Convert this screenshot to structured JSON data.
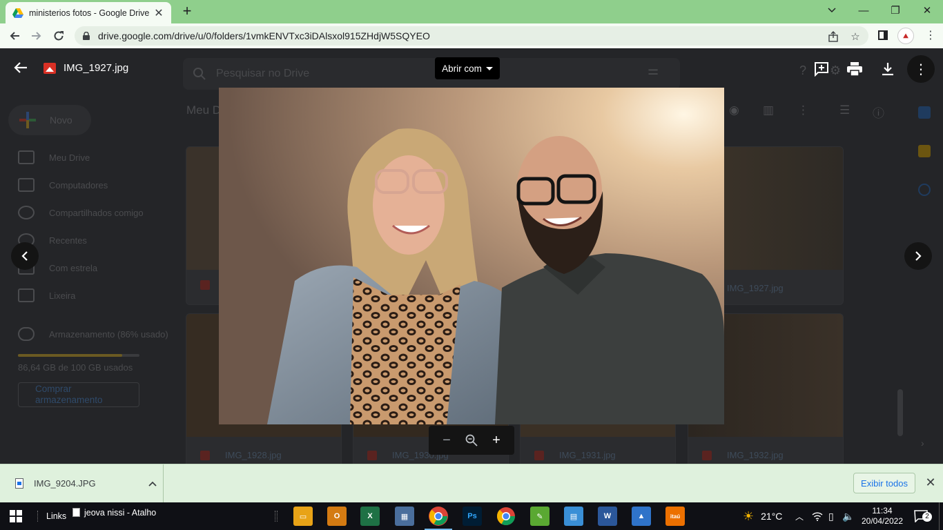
{
  "browser": {
    "tab_title": "ministerios fotos - Google Drive",
    "tab_close": "✕",
    "new_tab": "+",
    "url": "drive.google.com/drive/u/0/folders/1vmkENVTxc3iDAlsxol915ZHdjW5SQYEO",
    "win_min": "—",
    "win_restore": "❐",
    "win_close": "✕"
  },
  "drive": {
    "search_placeholder": "Pesquisar no Drive",
    "new_label": "Novo",
    "breadcrumb": "Meu Drive",
    "sidebar": [
      {
        "label": "Meu Drive",
        "icon": "drive-icon"
      },
      {
        "label": "Computadores",
        "icon": "computer-icon"
      },
      {
        "label": "Compartilhados comigo",
        "icon": "shared-icon"
      },
      {
        "label": "Recentes",
        "icon": "clock-icon"
      },
      {
        "label": "Com estrela",
        "icon": "star-icon"
      },
      {
        "label": "Lixeira",
        "icon": "trash-icon"
      }
    ],
    "storage_label": "Armazenamento (86% usado)",
    "storage_used_text": "86,64 GB de 100 GB usados",
    "storage_fraction": 0.86,
    "buy_storage": "Comprar armazenamento",
    "files": [
      {
        "name": "IMG_1927.jpg"
      },
      {
        "name": "IMG_1928.jpg"
      },
      {
        "name": "IMG_1930.jpg"
      },
      {
        "name": "IMG_1931.jpg"
      },
      {
        "name": "IMG_1932.jpg"
      }
    ]
  },
  "viewer": {
    "file_name": "IMG_1927.jpg",
    "open_with": "Abrir com",
    "back_icon": "←",
    "prev_icon": "‹",
    "next_icon": "›",
    "zoom_out": "−",
    "zoom_reset": "⌕",
    "zoom_in": "+"
  },
  "downloads": {
    "file_name": "IMG_9204.JPG",
    "show_all": "Exibir todos",
    "close": "✕"
  },
  "taskbar": {
    "links_label": "Links",
    "shortcut_label": "jeova nissi - Atalho",
    "temperature": "21°C",
    "time": "11:34",
    "date": "20/04/2022",
    "notifications": "2"
  },
  "colors": {
    "chrome_frame": "#8fcf8c",
    "toolbar": "#f5fbf4",
    "viewer_bg": "#202124",
    "shelf": "#dff1dd",
    "taskbar": "#0f1015"
  }
}
